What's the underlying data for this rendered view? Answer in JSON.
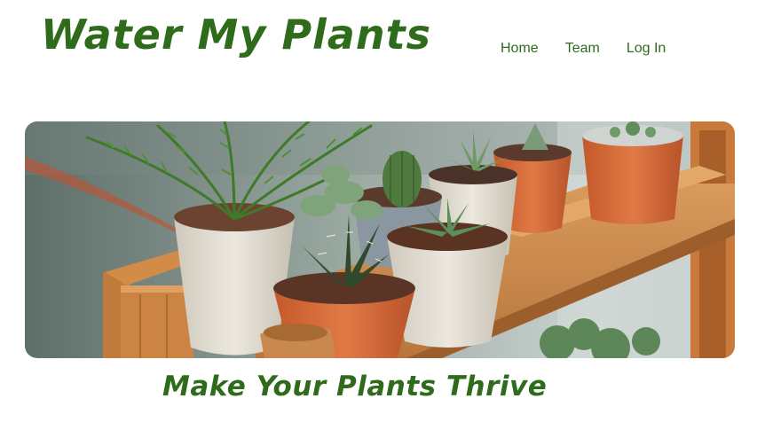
{
  "header": {
    "title": "Water My Plants",
    "nav": [
      {
        "label": "Home"
      },
      {
        "label": "Team"
      },
      {
        "label": "Log In"
      }
    ]
  },
  "hero": {
    "image": "potted-succulents-on-wooden-shelf"
  },
  "main": {
    "tagline": "Make Your Plants Thrive"
  },
  "colors": {
    "brand_green": "#2e6b1a",
    "background": "#ffffff"
  }
}
